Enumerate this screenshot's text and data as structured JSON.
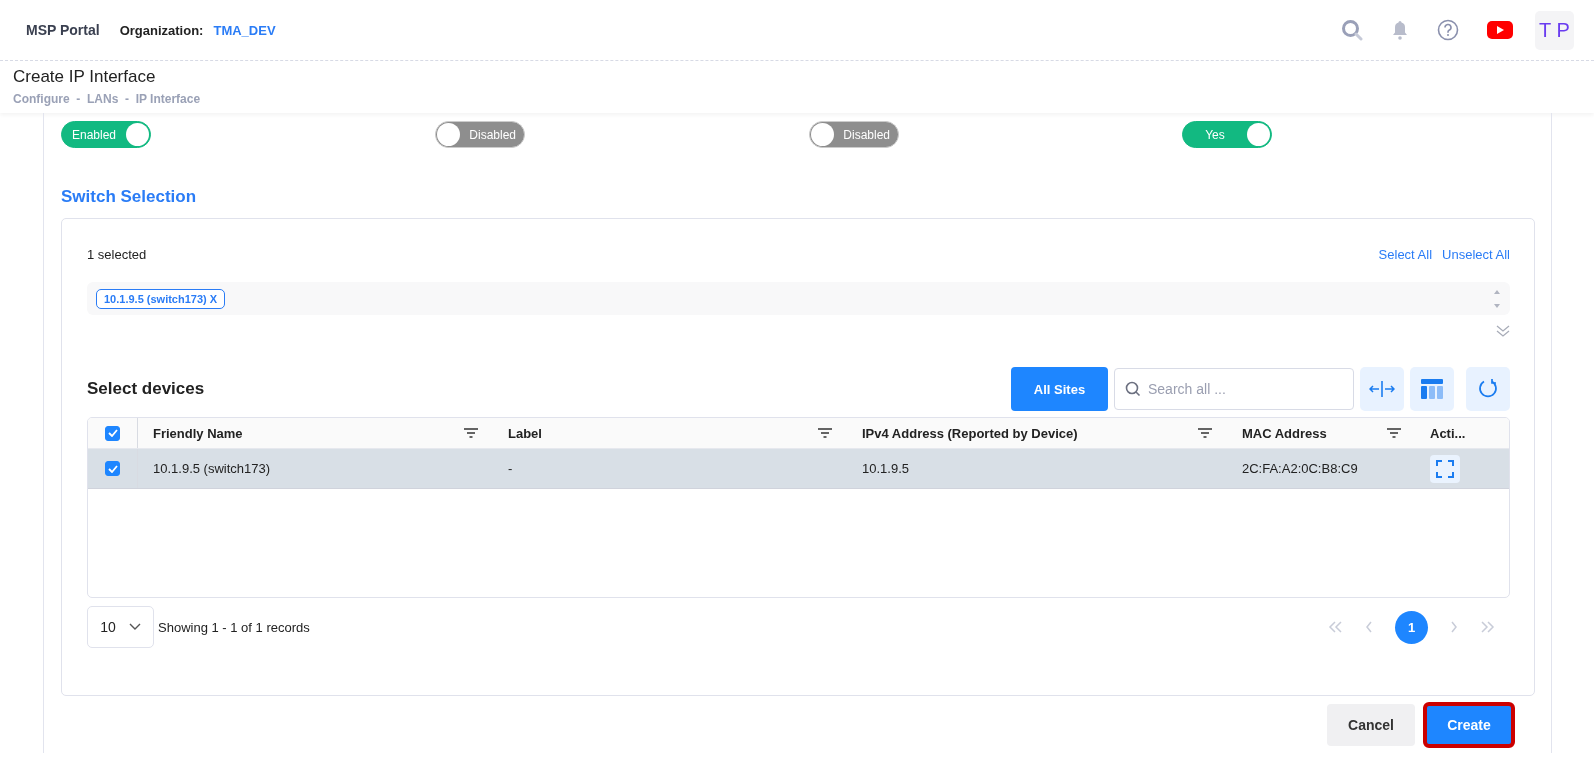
{
  "header": {
    "app_name": "MSP Portal",
    "org_label": "Organization:",
    "org_name": "TMA_DEV",
    "avatar": "T P"
  },
  "page": {
    "title": "Create IP Interface",
    "breadcrumb": "Configure  -  LANs  -  IP Interface"
  },
  "toggles": [
    {
      "text": "Enabled",
      "on": true
    },
    {
      "text": "Disabled",
      "on": false
    },
    {
      "text": "Disabled",
      "on": false
    },
    {
      "text": "Yes",
      "on": true
    }
  ],
  "switch_selection": {
    "heading": "Switch Selection",
    "count": "1 selected",
    "select_all": "Select All",
    "unselect_all": "Unselect All",
    "chips": [
      {
        "label": "10.1.9.5 (switch173)",
        "remove": "X"
      }
    ]
  },
  "devices": {
    "heading": "Select devices",
    "sites_button": "All Sites",
    "search": {
      "placeholder": "Search all ..."
    },
    "header_checked": true,
    "columns": [
      {
        "label": "Friendly Name",
        "filter": true
      },
      {
        "label": "Label",
        "filter": true
      },
      {
        "label": "IPv4 Address (Reported by Device)",
        "filter": true
      },
      {
        "label": "MAC Address",
        "filter": true
      },
      {
        "label": "Acti...",
        "filter": false
      }
    ],
    "rows": [
      {
        "checked": true,
        "selected": true,
        "cells": [
          "10.1.9.5 (switch173)",
          "-",
          "10.1.9.5",
          "2C:FA:A2:0C:B8:C9"
        ]
      }
    ],
    "page_size": "10",
    "summary": "Showing 1 - 1 of 1 records",
    "pages": [
      {
        "label": "1",
        "selected": true
      }
    ]
  },
  "actions": [
    {
      "label": "Cancel",
      "kind": "secondary",
      "highlighted": false
    },
    {
      "label": "Create",
      "kind": "primary",
      "highlighted": true
    }
  ]
}
